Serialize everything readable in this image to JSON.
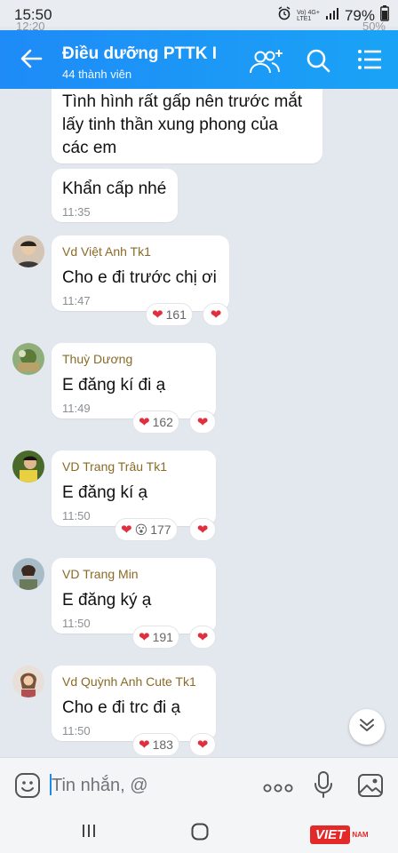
{
  "status_bar": {
    "time": "15:50",
    "battery": "79%",
    "network_top": "Vo) 4G+",
    "network_bottom": "LTE1",
    "ghost_time": "12:20",
    "ghost_right": "50%"
  },
  "header": {
    "title": "Điều dưỡng PTTK I",
    "subtitle": "44 thành viên"
  },
  "messages": [
    {
      "text_lines": [
        "Tình hình rất gấp nên trước mắt",
        "lấy tinh thần xung phong của",
        "các em"
      ]
    },
    {
      "text": "Khẩn cấp nhé",
      "time": "11:35"
    },
    {
      "sender": "Vd Việt Anh Tk1",
      "text": "Cho e đi trước chị ơi",
      "time": "11:47",
      "reaction_count": "161"
    },
    {
      "sender": "Thuỳ Dương",
      "text": "E đăng kí đi ạ",
      "time": "11:49",
      "reaction_count": "162"
    },
    {
      "sender": "VD Trang Trâu Tk1",
      "text": "E đăng kí ạ",
      "time": "11:50",
      "reaction_count": "177",
      "reaction_emoji": "😮"
    },
    {
      "sender": "VD Trang Min",
      "text": "E đăng ký ạ",
      "time": "11:50",
      "reaction_count": "191"
    },
    {
      "sender": "Vd Quỳnh Anh Cute Tk1",
      "text": "Cho e đi trc đi ạ",
      "time": "11:50",
      "reaction_count": "183"
    }
  ],
  "input": {
    "placeholder": "Tin nhắn, @"
  },
  "watermark": {
    "text": "VIET",
    "sub": "NAM"
  },
  "icons": {
    "back": "arrow-left-icon",
    "add_member": "add-member-icon",
    "search": "search-icon",
    "menu": "list-menu-icon",
    "sticker": "sticker-icon",
    "more": "more-icon",
    "mic": "microphone-icon",
    "image": "image-icon",
    "scroll": "chevron-double-down-icon"
  },
  "colors": {
    "header": "#1e8bf7",
    "heart": "#e0303f",
    "sender_name": "#8a6a26",
    "background": "#e3e8ee"
  }
}
